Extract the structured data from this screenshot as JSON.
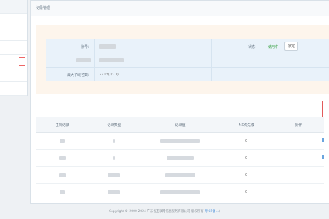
{
  "panel": {
    "title": "记录管理"
  },
  "info": {
    "labels": {
      "name": "账号：",
      "status": "状态：",
      "max_time": "最大子域名数："
    },
    "max_value": "2713(0/71)",
    "status_text": "使用中",
    "status_button": "锁定"
  },
  "table": {
    "columns": [
      "主机记录",
      "记录类型",
      "记录值",
      "MX优先级",
      "操作"
    ],
    "mx_values": [
      "0",
      "0",
      "0",
      "0"
    ]
  },
  "footer": {
    "text": "Copyright © 2000-2024 广东省互联网信息服务有限公司 版权所有(",
    "link": "粤ICP备…",
    "close": ")"
  },
  "colors": {
    "accent_green": "#3aa245",
    "highlight_red": "#e25b5b",
    "link_blue": "#4a90d9"
  }
}
